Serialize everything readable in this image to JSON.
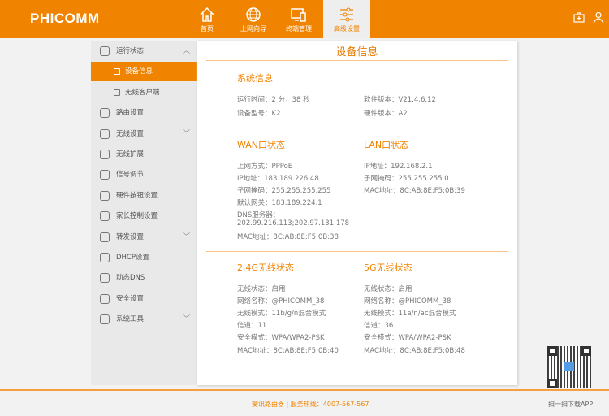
{
  "header": {
    "logo": "PHICOMM",
    "nav": [
      {
        "label": "首页",
        "icon": "home-icon"
      },
      {
        "label": "上网向导",
        "icon": "globe-icon"
      },
      {
        "label": "终端管理",
        "icon": "devices-icon"
      },
      {
        "label": "高级设置",
        "icon": "sliders-icon",
        "active": true
      }
    ]
  },
  "sidebar": {
    "items": [
      {
        "label": "运行状态",
        "chevron": "︿"
      },
      {
        "label": "设备信息",
        "sub": true,
        "active": true
      },
      {
        "label": "无线客户端",
        "sub": true
      },
      {
        "label": "路由设置"
      },
      {
        "label": "无线设置",
        "chevron": "﹀"
      },
      {
        "label": "无线扩展"
      },
      {
        "label": "信号调节"
      },
      {
        "label": "硬件按钮设置"
      },
      {
        "label": "家长控制设置"
      },
      {
        "label": "转发设置",
        "chevron": "﹀"
      },
      {
        "label": "DHCP设置"
      },
      {
        "label": "动态DNS"
      },
      {
        "label": "安全设置"
      },
      {
        "label": "系统工具",
        "chevron": "﹀"
      }
    ]
  },
  "main": {
    "title": "设备信息",
    "system": {
      "title": "系统信息",
      "uptime": "运行时间：2 分，38 秒",
      "software": "软件版本：V21.4.6.12",
      "model": "设备型号：K2",
      "hardware": "硬件版本：A2"
    },
    "wan": {
      "title": "WAN口状态",
      "rows": [
        "上网方式：PPPoE",
        "IP地址：183.189.226.48",
        "子网掩码：255.255.255.255",
        "默认网关：183.189.224.1",
        "DNS服务器：",
        "202.99.216.113;202.97.131.178",
        "MAC地址：8C:AB:8E:F5:0B:38"
      ]
    },
    "lan": {
      "title": "LAN口状态",
      "rows": [
        "IP地址：192.168.2.1",
        "子网掩码：255.255.255.0",
        "MAC地址：8C:AB:8E:F5:0B:39"
      ]
    },
    "w24": {
      "title": "2.4G无线状态",
      "rows": [
        "无线状态：启用",
        "网络名称：@PHICOMM_38",
        "无线模式：11b/g/n混合模式",
        "信道：11",
        "安全模式：WPA/WPA2-PSK",
        "MAC地址：8C:AB:8E:F5:0B:40"
      ]
    },
    "w5": {
      "title": "5G无线状态",
      "rows": [
        "无线状态：启用",
        "网络名称：@PHICOMM_38",
        "无线模式：11a/n/ac混合模式",
        "信道：36",
        "安全模式：WPA/WPA2-PSK",
        "MAC地址：8C:AB:8E:F5:0B:48"
      ]
    }
  },
  "footer": {
    "left": "斐讯路由器 | 服务热线：4007-567-567",
    "right": "扫一扫下载APP"
  },
  "colors": {
    "brand": "#f08300"
  }
}
